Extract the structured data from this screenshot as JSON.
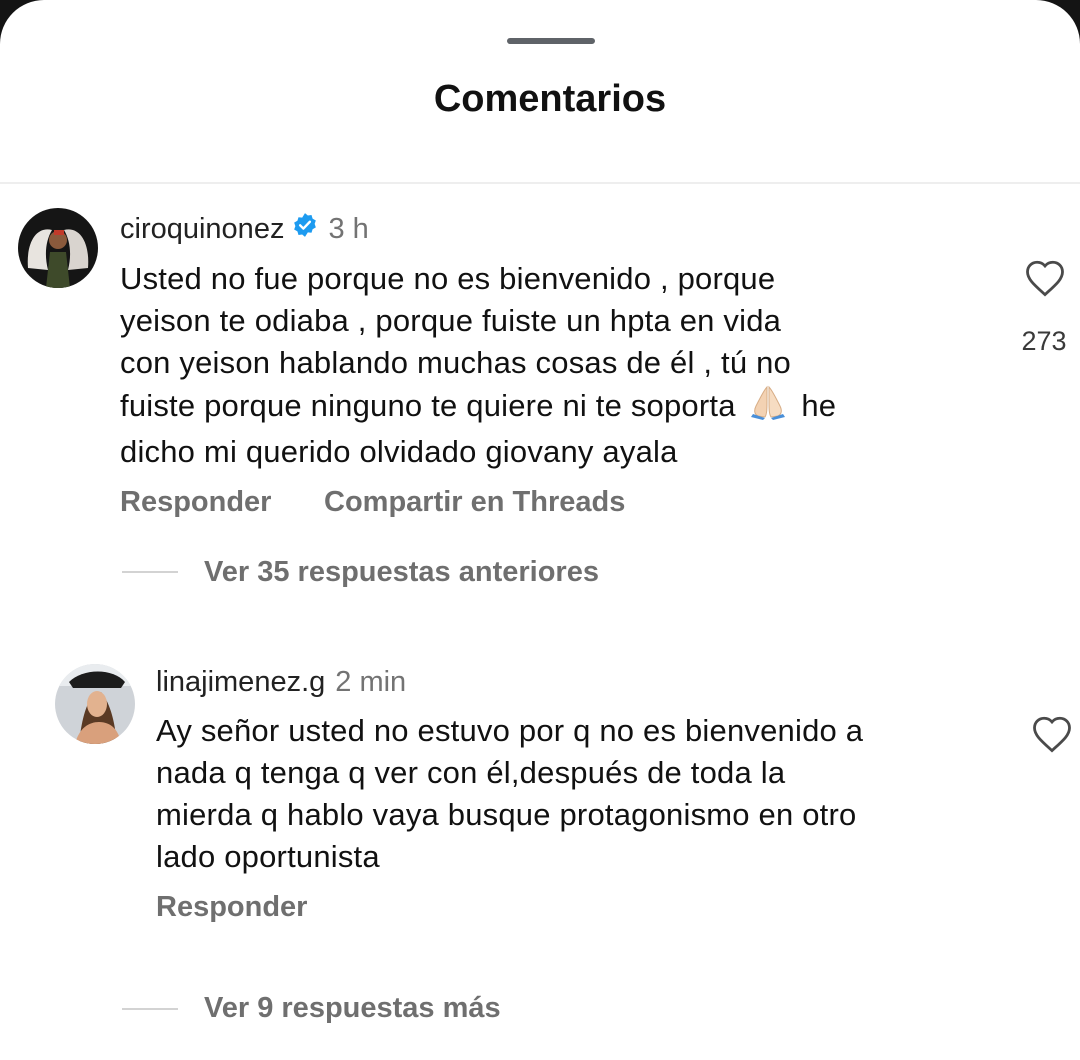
{
  "sheet": {
    "title": "Comentarios"
  },
  "comments": [
    {
      "username": "ciroquinonez",
      "verified": true,
      "time": "3 h",
      "lines": [
        "Usted no fue porque no es bienvenido , porque",
        "yeison te odiaba , porque fuiste un hpta en vida",
        "con yeison hablando muchas cosas de él , tú no",
        "fuiste porque ninguno te quiere ni te soporta",
        "he",
        "dicho mi querido olvidado giovany ayala"
      ],
      "emoji": "folded-hands-emoji",
      "likes": "273",
      "reply_label": "Responder",
      "share_label": "Compartir en Threads",
      "view_replies_label": "Ver 35 respuestas anteriores"
    },
    {
      "username": "linajimenez.g",
      "verified": false,
      "time": "2 min",
      "lines": [
        "Ay señor usted no estuvo por q no es bienvenido a",
        "nada q tenga q ver con él,después de toda la",
        "mierda q hablo vaya busque protagonismo en otro",
        "lado oportunista"
      ],
      "reply_label": "Responder",
      "view_replies_label": "Ver 9 respuestas más"
    }
  ],
  "icons": {
    "like": "heart-outline-icon",
    "verified": "verified-badge-icon"
  },
  "colors": {
    "verified": "#1d9bf0",
    "muted": "#737373",
    "text": "#111111"
  }
}
